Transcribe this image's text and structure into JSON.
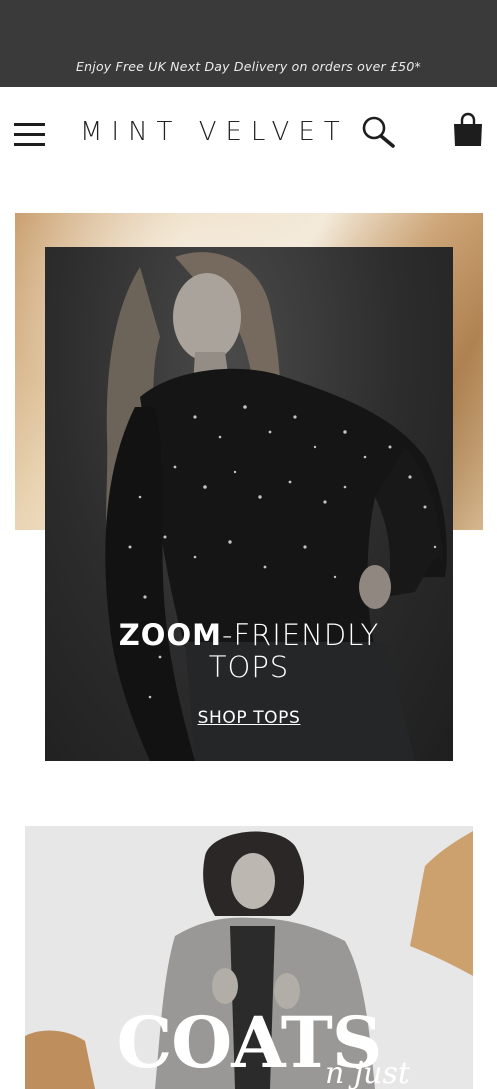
{
  "promo_bar": {
    "text": "Enjoy Free UK Next Day Delivery on orders over £50*"
  },
  "header": {
    "logo": "MINT VELVET",
    "icons": {
      "menu": "hamburger-menu-icon",
      "search": "search-icon",
      "bag": "shopping-bag-icon"
    }
  },
  "hero": {
    "title_bold": "ZOOM",
    "title_rest": "-FRIENDLY",
    "title_line2": "TOPS",
    "cta": "SHOP TOPS"
  },
  "coats_banner": {
    "title": "COATS",
    "script_fragment": "n just"
  },
  "colors": {
    "promo_bg": "#3a3a3b",
    "gold_accent": "#c99d6c",
    "text_dark": "#1d1d1d"
  }
}
